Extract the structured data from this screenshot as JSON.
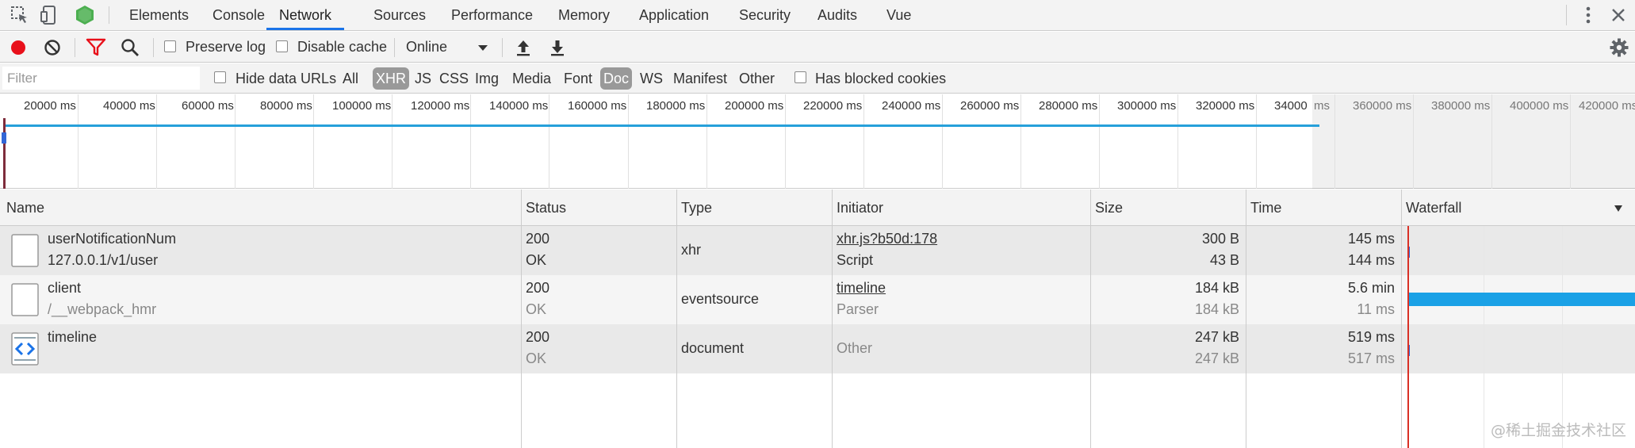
{
  "tabs": {
    "items": [
      {
        "label": "Elements"
      },
      {
        "label": "Console"
      },
      {
        "label": "Network"
      },
      {
        "label": "Sources"
      },
      {
        "label": "Performance"
      },
      {
        "label": "Memory"
      },
      {
        "label": "Application"
      },
      {
        "label": "Security"
      },
      {
        "label": "Audits"
      },
      {
        "label": "Vue"
      }
    ],
    "active": "Network"
  },
  "toolbar": {
    "preserve_log": "Preserve log",
    "disable_cache": "Disable cache",
    "throttle_value": "Online"
  },
  "filterbar": {
    "filter_placeholder": "Filter",
    "hide_data_urls": "Hide data URLs",
    "types": [
      "All",
      "XHR",
      "JS",
      "CSS",
      "Img",
      "Media",
      "Font",
      "Doc",
      "WS",
      "Manifest",
      "Other"
    ],
    "selected_types": [
      "XHR",
      "Doc"
    ],
    "blocked_cookies": "Has blocked cookies"
  },
  "overview": {
    "tick_labels": [
      "20000 ms",
      "40000 ms",
      "60000 ms",
      "80000 ms",
      "100000 ms",
      "120000 ms",
      "140000 ms",
      "160000 ms",
      "180000 ms",
      "200000 ms",
      "220000 ms",
      "240000 ms",
      "260000 ms",
      "280000 ms",
      "300000 ms",
      "320000 ms",
      "34000",
      "ms",
      "360000 ms",
      "380000 ms",
      "400000 ms",
      "420000 ms"
    ]
  },
  "table": {
    "headers": {
      "name": "Name",
      "status": "Status",
      "type": "Type",
      "initiator": "Initiator",
      "size": "Size",
      "time": "Time",
      "waterfall": "Waterfall"
    },
    "rows": [
      {
        "name": "userNotificationNum",
        "path": "127.0.0.1/v1/user",
        "status_code": "200",
        "status_text": "OK",
        "type": "xhr",
        "initiator": "xhr.js?b50d:178",
        "initiator_sub": "Script",
        "size": "300 B",
        "size_sub": "43 B",
        "time": "145 ms",
        "time_sub": "144 ms"
      },
      {
        "name": "client",
        "path": "/__webpack_hmr",
        "status_code": "200",
        "status_text": "OK",
        "type": "eventsource",
        "initiator": "timeline",
        "initiator_sub": "Parser",
        "size": "184 kB",
        "size_sub": "184 kB",
        "time": "5.6 min",
        "time_sub": "11 ms"
      },
      {
        "name": "timeline",
        "path": "",
        "status_code": "200",
        "status_text": "OK",
        "type": "document",
        "initiator": "Other",
        "initiator_sub": "",
        "size": "247 kB",
        "size_sub": "247 kB",
        "time": "519 ms",
        "time_sub": "517 ms"
      }
    ]
  },
  "watermark": "@稀土掘金技术社区",
  "colors": {
    "accent": "#1a73e8",
    "record": "#d93025",
    "filter_icon": "#d93025",
    "waterfall_bar": "#1aa1e6",
    "selected_type_bg": "#999999"
  }
}
